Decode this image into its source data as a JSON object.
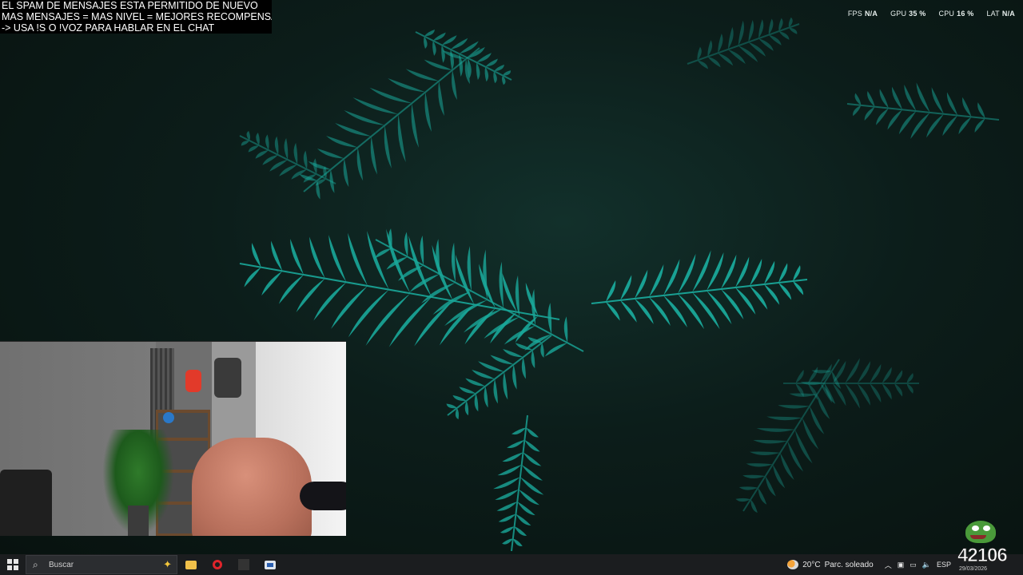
{
  "overlay": {
    "alert_lines": [
      "EL SPAM DE MENSAJES ESTA PERMITIDO DE NUEVO",
      "MAS MENSAJES = MAS NIVEL = MEJORES RECOMPENSAS",
      "-> USA !S  O !VOZ PARA HABLAR EN EL CHAT"
    ]
  },
  "performance": {
    "fps_label": "FPS",
    "fps_value": "N/A",
    "gpu_label": "GPU",
    "gpu_value": "35 %",
    "cpu_label": "CPU",
    "cpu_value": "16 %",
    "lat_label": "LAT",
    "lat_value": "N/A"
  },
  "taskbar": {
    "search_placeholder": "Buscar",
    "weather_temp": "20°C",
    "weather_desc": "Parc. soleado",
    "language": "ESP",
    "counter": "42106",
    "date": "29/03/2026"
  },
  "icons": {
    "start": "windows-icon",
    "search": "search-icon",
    "copilot": "sparkle-icon",
    "explorer": "folder-icon",
    "browser": "opera-icon",
    "weather": "partly-sunny-icon"
  },
  "colors": {
    "fern": "#1aa89a",
    "taskbar_bg": "#1b1d1f",
    "accent_red": "#e0242b"
  }
}
